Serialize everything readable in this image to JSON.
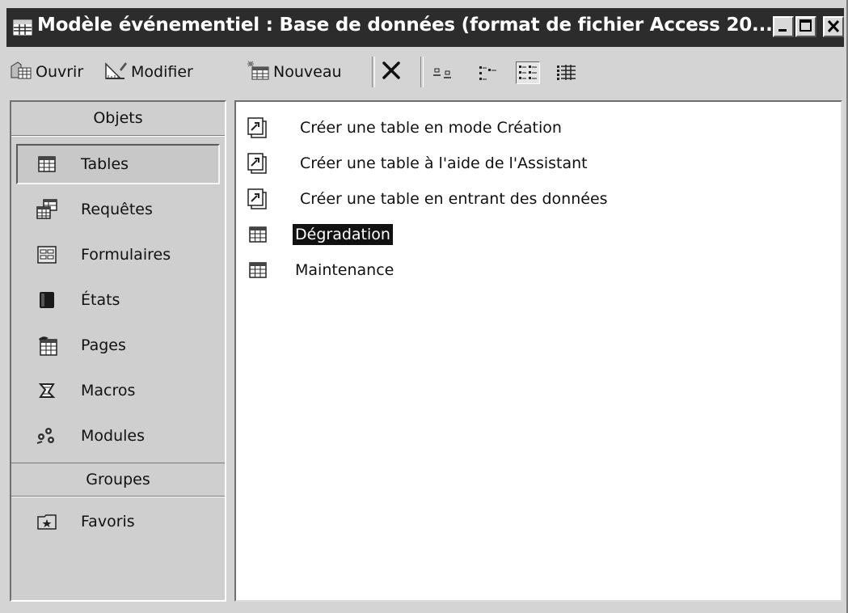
{
  "window": {
    "title": "Modèle événementiel : Base de données (format de fichier Access 20..."
  },
  "toolbar": {
    "open_label": "Ouvrir",
    "modify_label": "Modifier",
    "new_label": "Nouveau"
  },
  "objects_bar": {
    "objects_header": "Objets",
    "items": [
      {
        "label": "Tables",
        "icon": "table-icon"
      },
      {
        "label": "Requêtes",
        "icon": "query-icon"
      },
      {
        "label": "Formulaires",
        "icon": "form-icon"
      },
      {
        "label": "États",
        "icon": "report-icon"
      },
      {
        "label": "Pages",
        "icon": "page-icon"
      },
      {
        "label": "Macros",
        "icon": "macro-icon"
      },
      {
        "label": "Modules",
        "icon": "module-icon"
      }
    ],
    "selected": "Tables",
    "groups_header": "Groupes",
    "groups": [
      {
        "label": "Favoris",
        "icon": "favorites-icon"
      }
    ]
  },
  "list": {
    "items": [
      {
        "label": "Créer une table en mode Création",
        "icon": "wizard-shortcut-icon"
      },
      {
        "label": "Créer une table à l'aide de l'Assistant",
        "icon": "wizard-shortcut-icon"
      },
      {
        "label": "Créer une table en entrant des données",
        "icon": "wizard-shortcut-icon"
      },
      {
        "label": "Dégradation",
        "icon": "table-icon"
      },
      {
        "label": "Maintenance",
        "icon": "table-icon"
      }
    ],
    "selected": "Dégradation"
  },
  "colors": {
    "title_bar": "#2c2c2c",
    "window_face": "#d4d4d4",
    "list_background": "#ffffff",
    "selection": "#111111"
  }
}
